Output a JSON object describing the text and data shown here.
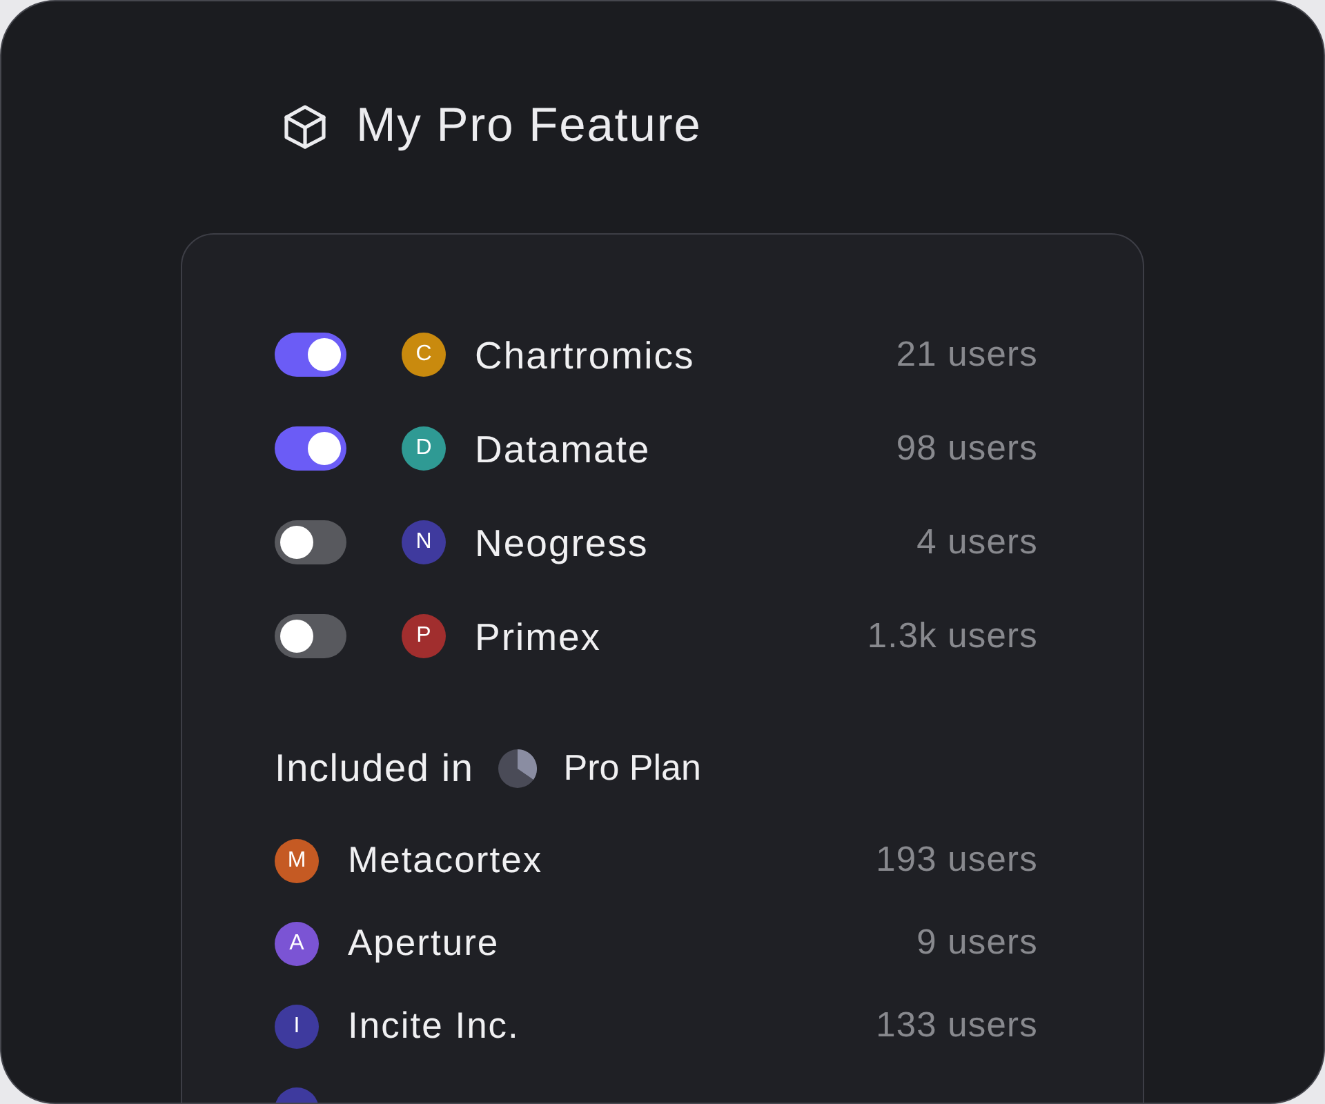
{
  "title": "My Pro Feature",
  "integrations": [
    {
      "initial": "C",
      "name": "Chartromics",
      "users": "21 users",
      "on": true,
      "color": "#c98a0e"
    },
    {
      "initial": "D",
      "name": "Datamate",
      "users": "98 users",
      "on": true,
      "color": "#2f9a94"
    },
    {
      "initial": "N",
      "name": "Neogress",
      "users": "4 users",
      "on": false,
      "color": "#3f3a9e"
    },
    {
      "initial": "P",
      "name": "Primex",
      "users": "1.3k users",
      "on": false,
      "color": "#a12e2e"
    }
  ],
  "included": {
    "label": "Included in",
    "plan": "Pro Plan",
    "teams": [
      {
        "initial": "M",
        "name": "Metacortex",
        "users": "193 users",
        "color": "#c55a23"
      },
      {
        "initial": "A",
        "name": "Aperture",
        "users": "9 users",
        "color": "#7b54d4"
      },
      {
        "initial": "I",
        "name": "Incite Inc.",
        "users": "133 users",
        "color": "#3e3a9e"
      },
      {
        "color": "#3e3a9e"
      }
    ]
  }
}
